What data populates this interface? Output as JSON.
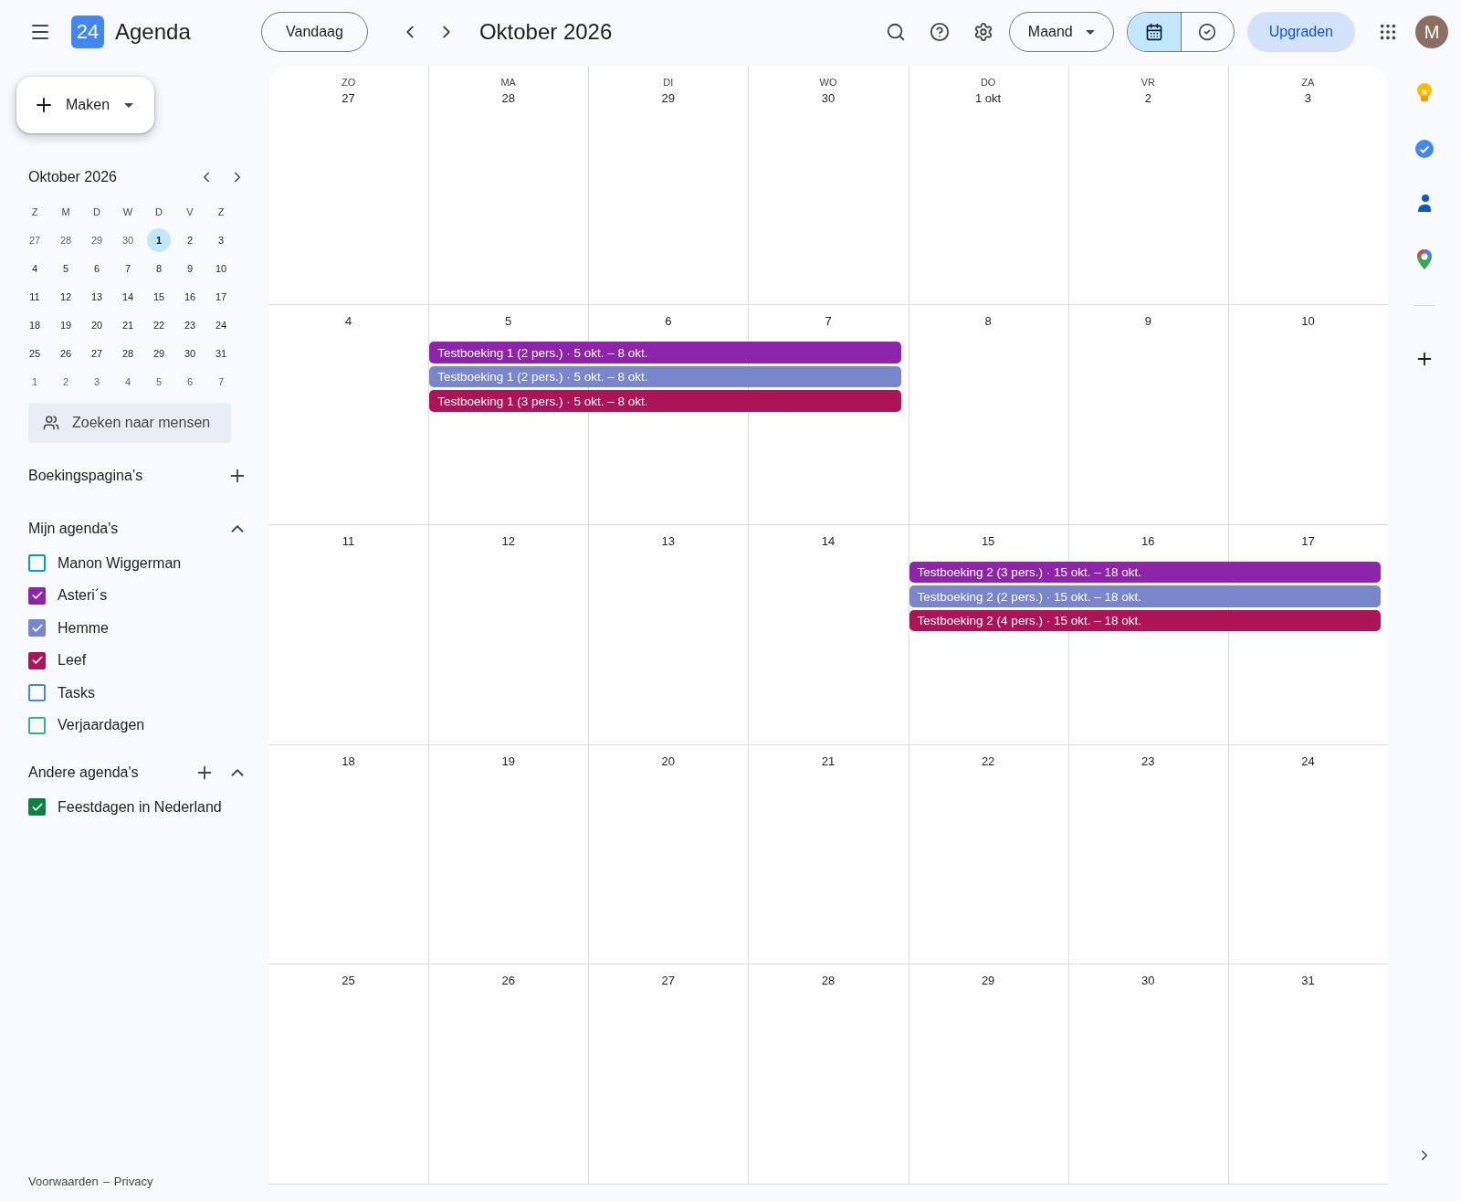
{
  "header": {
    "logo_text": "24",
    "app_name": "Agenda",
    "today_button": "Vandaag",
    "period_title": "Oktober 2026",
    "view_select": "Maand",
    "view_toggle": [
      {
        "kind": "calendar",
        "selected": true
      },
      {
        "kind": "tasks",
        "selected": false
      }
    ],
    "upgrade_button": "Upgraden",
    "avatar_letter": "M"
  },
  "sidebar": {
    "create_button": "Maken",
    "mini_calendar": {
      "title": "Oktober 2026",
      "weekdays": [
        "Z",
        "M",
        "D",
        "W",
        "D",
        "V",
        "Z"
      ],
      "weeks": [
        {
          "days": [
            {
              "label": "27",
              "outside": true,
              "selected": false
            },
            {
              "label": "28",
              "outside": true,
              "selected": false
            },
            {
              "label": "29",
              "outside": true,
              "selected": false
            },
            {
              "label": "30",
              "outside": true,
              "selected": false
            },
            {
              "label": "1",
              "outside": false,
              "selected": true
            },
            {
              "label": "2",
              "outside": false,
              "selected": false
            },
            {
              "label": "3",
              "outside": false,
              "selected": false
            }
          ]
        },
        {
          "days": [
            {
              "label": "4",
              "outside": false,
              "selected": false
            },
            {
              "label": "5",
              "outside": false,
              "selected": false
            },
            {
              "label": "6",
              "outside": false,
              "selected": false
            },
            {
              "label": "7",
              "outside": false,
              "selected": false
            },
            {
              "label": "8",
              "outside": false,
              "selected": false
            },
            {
              "label": "9",
              "outside": false,
              "selected": false
            },
            {
              "label": "10",
              "outside": false,
              "selected": false
            }
          ]
        },
        {
          "days": [
            {
              "label": "11",
              "outside": false,
              "selected": false
            },
            {
              "label": "12",
              "outside": false,
              "selected": false
            },
            {
              "label": "13",
              "outside": false,
              "selected": false
            },
            {
              "label": "14",
              "outside": false,
              "selected": false
            },
            {
              "label": "15",
              "outside": false,
              "selected": false
            },
            {
              "label": "16",
              "outside": false,
              "selected": false
            },
            {
              "label": "17",
              "outside": false,
              "selected": false
            }
          ]
        },
        {
          "days": [
            {
              "label": "18",
              "outside": false,
              "selected": false
            },
            {
              "label": "19",
              "outside": false,
              "selected": false
            },
            {
              "label": "20",
              "outside": false,
              "selected": false
            },
            {
              "label": "21",
              "outside": false,
              "selected": false
            },
            {
              "label": "22",
              "outside": false,
              "selected": false
            },
            {
              "label": "23",
              "outside": false,
              "selected": false
            },
            {
              "label": "24",
              "outside": false,
              "selected": false
            }
          ]
        },
        {
          "days": [
            {
              "label": "25",
              "outside": false,
              "selected": false
            },
            {
              "label": "26",
              "outside": false,
              "selected": false
            },
            {
              "label": "27",
              "outside": false,
              "selected": false
            },
            {
              "label": "28",
              "outside": false,
              "selected": false
            },
            {
              "label": "29",
              "outside": false,
              "selected": false
            },
            {
              "label": "30",
              "outside": false,
              "selected": false
            },
            {
              "label": "31",
              "outside": false,
              "selected": false
            }
          ]
        },
        {
          "days": [
            {
              "label": "1",
              "outside": true,
              "selected": false
            },
            {
              "label": "2",
              "outside": true,
              "selected": false
            },
            {
              "label": "3",
              "outside": true,
              "selected": false
            },
            {
              "label": "4",
              "outside": true,
              "selected": false
            },
            {
              "label": "5",
              "outside": true,
              "selected": false
            },
            {
              "label": "6",
              "outside": true,
              "selected": false
            },
            {
              "label": "7",
              "outside": true,
              "selected": false
            }
          ]
        }
      ]
    },
    "people_search": {
      "placeholder": "Zoeken naar mensen"
    },
    "booking_pages": {
      "title": "Boekingspagina’s"
    },
    "my_calendars": {
      "title": "Mijn agenda's",
      "expanded": true,
      "items": [
        {
          "name": "Manon Wiggerman",
          "checked": false,
          "color": "#039be5"
        },
        {
          "name": "Asteri´s",
          "checked": true,
          "color": "#8e24aa"
        },
        {
          "name": "Hemme",
          "checked": true,
          "color": "#7986cb"
        },
        {
          "name": "Leef",
          "checked": true,
          "color": "#ad1457"
        },
        {
          "name": "Tasks",
          "checked": false,
          "color": "#4285f4"
        },
        {
          "name": "Verjaardagen",
          "checked": false,
          "color": "#33b679"
        }
      ]
    },
    "other_calendars": {
      "title": "Andere agenda's",
      "expanded": true,
      "items": [
        {
          "name": "Feestdagen in Nederland",
          "checked": true,
          "color": "#0b8043"
        }
      ]
    },
    "footer": {
      "links": [
        "Voorwaarden",
        "Privacy"
      ],
      "separator": "–"
    }
  },
  "month": {
    "weekdays": [
      "ZO",
      "MA",
      "DI",
      "WO",
      "DO",
      "VR",
      "ZA"
    ],
    "weeks": [
      {
        "days": [
          {
            "label": "27"
          },
          {
            "label": "28"
          },
          {
            "label": "29"
          },
          {
            "label": "30"
          },
          {
            "label": "1 okt"
          },
          {
            "label": "2"
          },
          {
            "label": "3"
          }
        ]
      },
      {
        "days": [
          {
            "label": "4"
          },
          {
            "label": "5",
            "bars": [
              {
                "kind": "start",
                "title": "Testboeking 1 (2 pers.) · 5 okt. – 8 okt.",
                "color": "#8e24aa"
              },
              {
                "kind": "start",
                "title": "Testboeking 1 (2 pers.) · 5 okt. – 8 okt.",
                "color": "#7986cb"
              },
              {
                "kind": "start",
                "title": "Testboeking 1 (3 pers.) · 5 okt. – 8 okt.",
                "color": "#ad1457"
              }
            ]
          },
          {
            "label": "6",
            "bars": [
              {
                "kind": "continue"
              },
              {
                "kind": "continue"
              },
              {
                "kind": "continue"
              }
            ]
          },
          {
            "label": "7",
            "bars": [
              {
                "kind": "continue"
              },
              {
                "kind": "continue"
              },
              {
                "kind": "continue"
              }
            ]
          },
          {
            "label": "8"
          },
          {
            "label": "9"
          },
          {
            "label": "10"
          }
        ]
      },
      {
        "days": [
          {
            "label": "11"
          },
          {
            "label": "12"
          },
          {
            "label": "13"
          },
          {
            "label": "14"
          },
          {
            "label": "15",
            "bars": [
              {
                "kind": "start",
                "title": "Testboeking 2 (3 pers.) · 15 okt. – 18 okt.",
                "color": "#8e24aa"
              },
              {
                "kind": "start",
                "title": "Testboeking 2 (2 pers.) · 15 okt. – 18 okt.",
                "color": "#7986cb"
              },
              {
                "kind": "start",
                "title": "Testboeking 2 (4 pers.) · 15 okt. – 18 okt.",
                "color": "#ad1457"
              }
            ]
          },
          {
            "label": "16",
            "bars": [
              {
                "kind": "continue"
              },
              {
                "kind": "continue"
              },
              {
                "kind": "continue"
              }
            ]
          },
          {
            "label": "17",
            "bars": [
              {
                "kind": "continue"
              },
              {
                "kind": "continue"
              },
              {
                "kind": "continue"
              }
            ]
          }
        ]
      },
      {
        "days": [
          {
            "label": "18"
          },
          {
            "label": "19"
          },
          {
            "label": "20"
          },
          {
            "label": "21"
          },
          {
            "label": "22"
          },
          {
            "label": "23"
          },
          {
            "label": "24"
          }
        ]
      },
      {
        "days": [
          {
            "label": "25"
          },
          {
            "label": "26"
          },
          {
            "label": "27"
          },
          {
            "label": "28"
          },
          {
            "label": "29"
          },
          {
            "label": "30"
          },
          {
            "label": "31"
          }
        ]
      }
    ]
  }
}
